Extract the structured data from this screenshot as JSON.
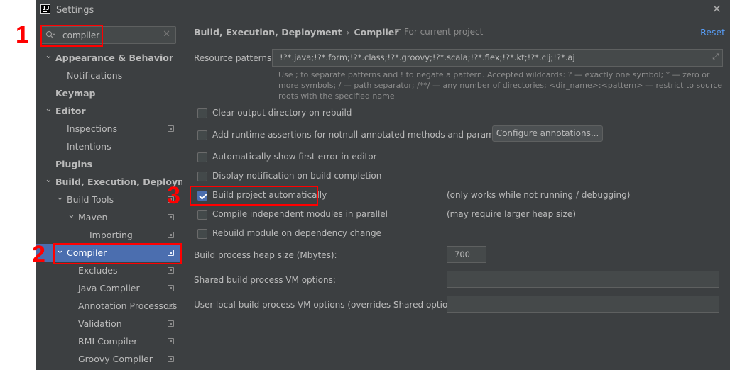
{
  "window": {
    "title": "Settings",
    "app_icon_text": "IJ"
  },
  "sidebar": {
    "search_value": "compiler",
    "items": [
      {
        "label": "Appearance & Behavior",
        "chevron": "down",
        "bold": true
      },
      {
        "label": "Notifications"
      },
      {
        "label": "Keymap",
        "bold": true
      },
      {
        "label": "Editor",
        "chevron": "down",
        "bold": true
      },
      {
        "label": "Inspections",
        "project_icon": true
      },
      {
        "label": "Intentions"
      },
      {
        "label": "Plugins",
        "bold": true
      },
      {
        "label": "Build, Execution, Deployment",
        "chevron": "down",
        "bold": true
      },
      {
        "label": "Build Tools",
        "chevron": "down",
        "project_icon": true
      },
      {
        "label": "Maven",
        "chevron": "down",
        "project_icon": true
      },
      {
        "label": "Importing",
        "project_icon": true
      },
      {
        "label": "Compiler",
        "chevron": "down",
        "project_icon": true,
        "selected": true
      },
      {
        "label": "Excludes",
        "project_icon": true
      },
      {
        "label": "Java Compiler",
        "project_icon": true
      },
      {
        "label": "Annotation Processors",
        "project_icon": true
      },
      {
        "label": "Validation",
        "project_icon": true
      },
      {
        "label": "RMI Compiler",
        "project_icon": true
      },
      {
        "label": "Groovy Compiler",
        "project_icon": true
      }
    ]
  },
  "content": {
    "breadcrumb": [
      "Build, Execution, Deployment",
      "Compiler"
    ],
    "scope": "For current project",
    "reset": "Reset",
    "resource_patterns": {
      "label": "Resource patterns:",
      "value": "!?*.java;!?*.form;!?*.class;!?*.groovy;!?*.scala;!?*.flex;!?*.kt;!?*.clj;!?*.aj"
    },
    "hint": "Use ; to separate patterns and ! to negate a pattern. Accepted wildcards: ? — exactly one symbol; * — zero or more symbols; / — path separator; /**/ — any number of directories; <dir_name>:<pattern> — restrict to source roots with the specified name",
    "checkboxes": [
      {
        "label": "Clear output directory on rebuild",
        "checked": false
      },
      {
        "label": "Add runtime assertions for notnull-annotated methods and parameters",
        "checked": false,
        "button": "Configure annotations..."
      },
      {
        "label": "Automatically show first error in editor",
        "checked": false
      },
      {
        "label": "Display notification on build completion",
        "checked": false
      },
      {
        "label": "Build project automatically",
        "checked": true,
        "note": "(only works while not running / debugging)"
      },
      {
        "label": "Compile independent modules in parallel",
        "checked": false,
        "note": "(may require larger heap size)"
      },
      {
        "label": "Rebuild module on dependency change",
        "checked": false
      }
    ],
    "heap_size": {
      "label": "Build process heap size (Mbytes):",
      "value": "700"
    },
    "shared_vm": {
      "label": "Shared build process VM options:",
      "value": ""
    },
    "user_vm": {
      "label": "User-local build process VM options (overrides Shared options):",
      "value": ""
    }
  },
  "annotations": [
    "1",
    "2",
    "3"
  ],
  "colors": {
    "selection": "#4b6eaf",
    "link": "#589df6",
    "annotation": "#ff0000",
    "background": "#3c3f41"
  }
}
